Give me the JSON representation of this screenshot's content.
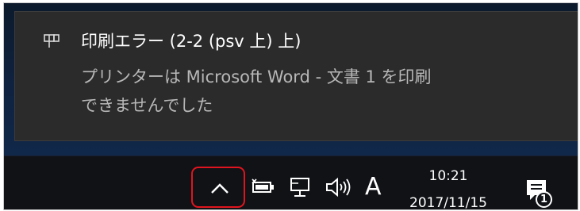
{
  "toast": {
    "icon": "printer-icon",
    "title": "印刷エラー (2-2 (psv 上) 上)",
    "message_line1": "プリンターは Microsoft Word - 文書 1 を印刷",
    "message_line2": "できませんでした"
  },
  "taskbar": {
    "tray_icons": [
      "chevron-up-icon",
      "power-icon",
      "network-icon",
      "volume-icon"
    ],
    "ime_indicator": "A",
    "time": "10:21",
    "date": "2017/11/15",
    "notification_count": "1",
    "highlight_color": "#e0141e"
  }
}
